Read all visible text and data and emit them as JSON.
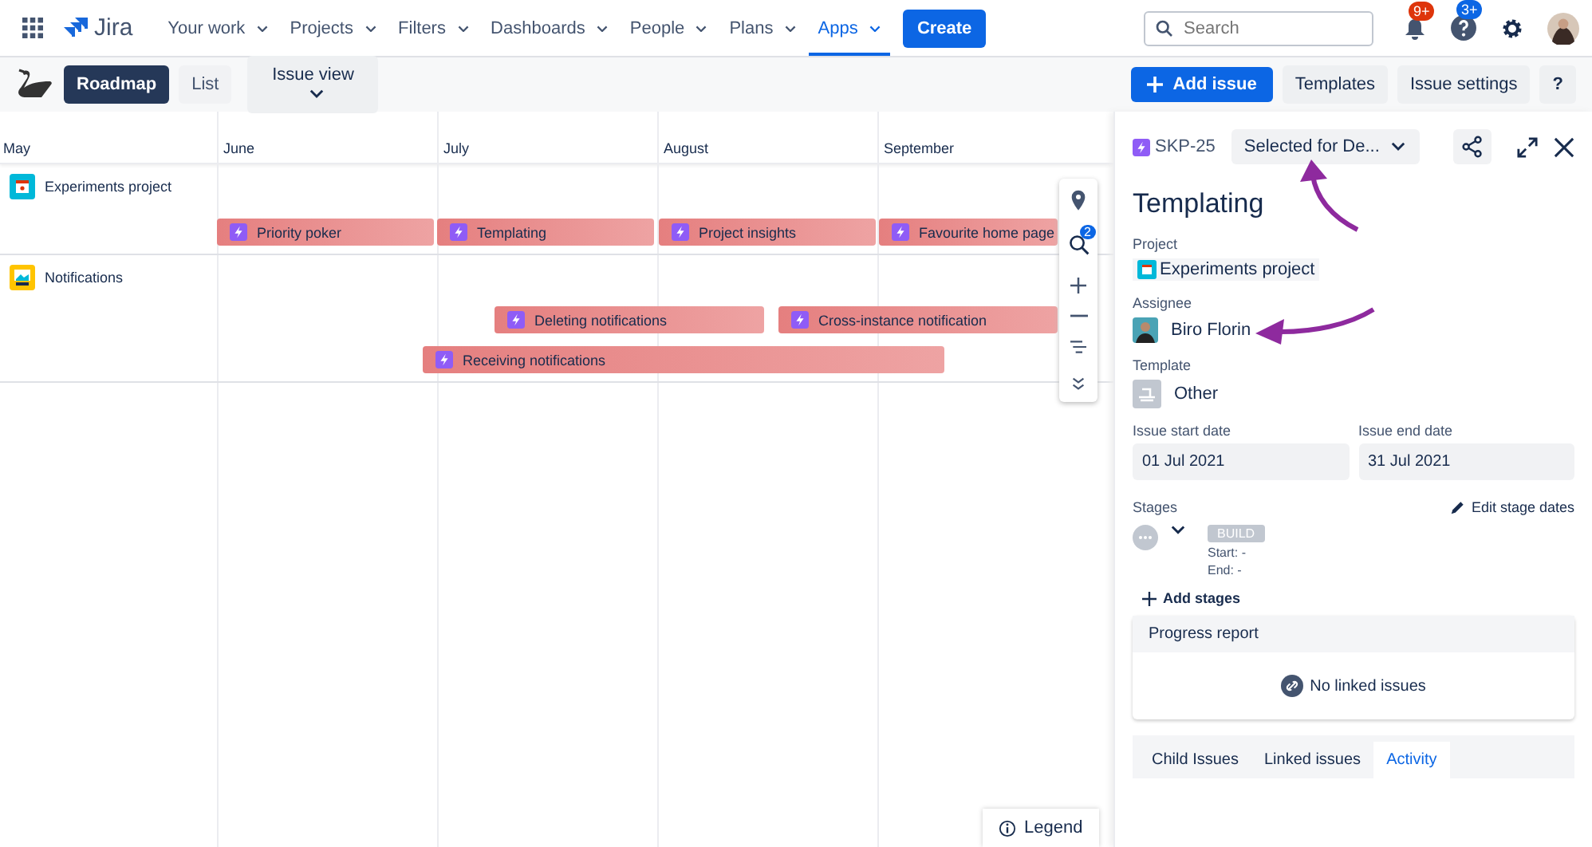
{
  "nav": {
    "product": "Jira",
    "items": [
      {
        "label": "Your work",
        "selected": false
      },
      {
        "label": "Projects",
        "selected": false
      },
      {
        "label": "Filters",
        "selected": false
      },
      {
        "label": "Dashboards",
        "selected": false
      },
      {
        "label": "People",
        "selected": false
      },
      {
        "label": "Plans",
        "selected": false
      },
      {
        "label": "Apps",
        "selected": true
      }
    ],
    "create": "Create",
    "search": {
      "placeholder": "Search"
    },
    "notifications_badge": "9+",
    "help_badge": "3+"
  },
  "toolbar": {
    "views": [
      {
        "label": "Roadmap",
        "selected": true
      },
      {
        "label": "List",
        "selected": false
      }
    ],
    "issue_view": "Issue view",
    "add_issue": "Add issue",
    "templates": "Templates",
    "issue_settings": "Issue settings",
    "help": "?"
  },
  "timeline": {
    "months": [
      "May",
      "June",
      "July",
      "August",
      "September"
    ],
    "groups": [
      {
        "name": "Experiments project",
        "bars": [
          {
            "label": "Priority poker"
          },
          {
            "label": "Templating"
          },
          {
            "label": "Project insights"
          },
          {
            "label": "Favourite home page"
          }
        ]
      },
      {
        "name": "Notifications",
        "bars": [
          {
            "label": "Deleting notifications"
          },
          {
            "label": "Cross-instance notification"
          },
          {
            "label": "Receiving notifications"
          }
        ]
      }
    ],
    "search_badge": "2",
    "legend": "Legend"
  },
  "panel": {
    "key": "SKP-25",
    "status": "Selected for De...",
    "title": "Templating",
    "fields": [
      {
        "label": "Project",
        "value": "Experiments project"
      },
      {
        "label": "Assignee",
        "value": "Biro Florin"
      },
      {
        "label": "Template",
        "value": "Other"
      }
    ],
    "dates": [
      {
        "label": "Issue start date",
        "value": "01 Jul 2021"
      },
      {
        "label": "Issue end date",
        "value": "31 Jul 2021"
      }
    ],
    "stages": {
      "label": "Stages",
      "edit": "Edit stage dates",
      "stage": "BUILD",
      "start": "Start: -",
      "end": "End: -",
      "add": "Add stages"
    },
    "progress": {
      "title": "Progress report",
      "empty": "No linked issues"
    },
    "tabs": [
      {
        "label": "Child Issues",
        "selected": false
      },
      {
        "label": "Linked issues",
        "selected": false
      },
      {
        "label": "Activity",
        "selected": true
      }
    ]
  }
}
